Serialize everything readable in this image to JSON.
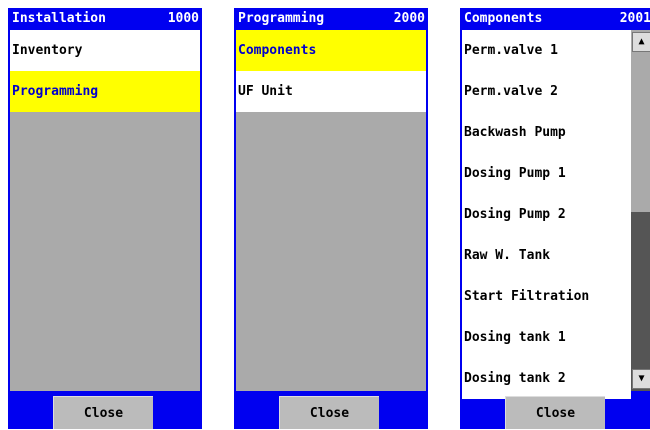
{
  "panels": [
    {
      "title": "Installation",
      "code": "1000",
      "items": [
        "Inventory",
        "Programming"
      ],
      "selected_index": 1,
      "close_label": "Close"
    },
    {
      "title": "Programming",
      "code": "2000",
      "items": [
        "Components",
        "UF Unit"
      ],
      "selected_index": 0,
      "close_label": "Close"
    },
    {
      "title": "Components",
      "code": "2001",
      "items": [
        "Perm.valve 1",
        "Perm.valve 2",
        "Backwash Pump",
        "Dosing Pump 1",
        "Dosing Pump 2",
        "Raw W. Tank",
        "Start Filtration",
        "Dosing tank 1",
        "Dosing tank 2"
      ],
      "close_label": "Close",
      "scroll_up_icon": "▲",
      "scroll_down_icon": "▼"
    }
  ],
  "colors": {
    "panel_blue": "#0000f0",
    "selected_bg": "#ffff00",
    "selected_text": "#0000cc",
    "list_empty_bg": "#aaaaaa"
  }
}
